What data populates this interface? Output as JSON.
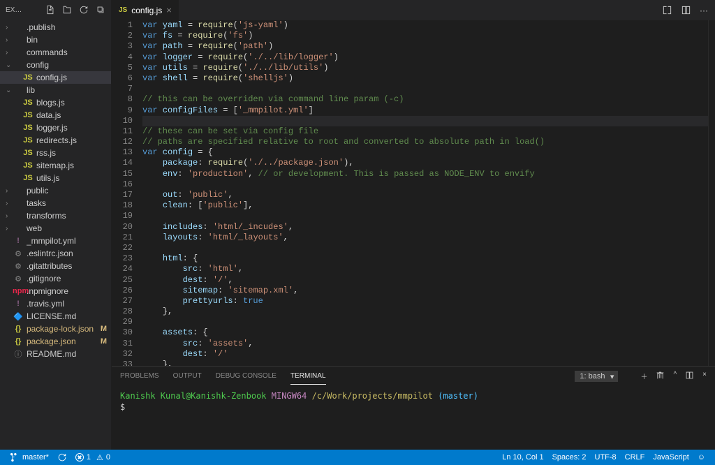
{
  "explorer": {
    "title": "EX…",
    "tree": [
      {
        "depth": 0,
        "chev": "›",
        "icon": "",
        "ic": "",
        "label": ".publish",
        "sel": false,
        "badge": ""
      },
      {
        "depth": 0,
        "chev": "›",
        "icon": "",
        "ic": "",
        "label": "bin",
        "sel": false,
        "badge": ""
      },
      {
        "depth": 0,
        "chev": "›",
        "icon": "",
        "ic": "",
        "label": "commands",
        "sel": false,
        "badge": ""
      },
      {
        "depth": 0,
        "chev": "⌄",
        "icon": "",
        "ic": "",
        "label": "config",
        "sel": false,
        "badge": ""
      },
      {
        "depth": 1,
        "chev": "",
        "icon": "JS",
        "ic": "ic-js",
        "label": "config.js",
        "sel": true,
        "badge": ""
      },
      {
        "depth": 0,
        "chev": "⌄",
        "icon": "",
        "ic": "",
        "label": "lib",
        "sel": false,
        "badge": ""
      },
      {
        "depth": 1,
        "chev": "",
        "icon": "JS",
        "ic": "ic-js",
        "label": "blogs.js",
        "sel": false,
        "badge": ""
      },
      {
        "depth": 1,
        "chev": "",
        "icon": "JS",
        "ic": "ic-js",
        "label": "data.js",
        "sel": false,
        "badge": ""
      },
      {
        "depth": 1,
        "chev": "",
        "icon": "JS",
        "ic": "ic-js",
        "label": "logger.js",
        "sel": false,
        "badge": ""
      },
      {
        "depth": 1,
        "chev": "",
        "icon": "JS",
        "ic": "ic-js",
        "label": "redirects.js",
        "sel": false,
        "badge": ""
      },
      {
        "depth": 1,
        "chev": "",
        "icon": "JS",
        "ic": "ic-js",
        "label": "rss.js",
        "sel": false,
        "badge": ""
      },
      {
        "depth": 1,
        "chev": "",
        "icon": "JS",
        "ic": "ic-js",
        "label": "sitemap.js",
        "sel": false,
        "badge": ""
      },
      {
        "depth": 1,
        "chev": "",
        "icon": "JS",
        "ic": "ic-js",
        "label": "utils.js",
        "sel": false,
        "badge": ""
      },
      {
        "depth": 0,
        "chev": "›",
        "icon": "",
        "ic": "",
        "label": "public",
        "sel": false,
        "badge": ""
      },
      {
        "depth": 0,
        "chev": "›",
        "icon": "",
        "ic": "",
        "label": "tasks",
        "sel": false,
        "badge": ""
      },
      {
        "depth": 0,
        "chev": "›",
        "icon": "",
        "ic": "",
        "label": "transforms",
        "sel": false,
        "badge": ""
      },
      {
        "depth": 0,
        "chev": "›",
        "icon": "",
        "ic": "",
        "label": "web",
        "sel": false,
        "badge": ""
      },
      {
        "depth": 0,
        "chev": "",
        "icon": "!",
        "ic": "ic-yml",
        "label": "_mmpilot.yml",
        "sel": false,
        "badge": ""
      },
      {
        "depth": 0,
        "chev": "",
        "icon": "⚙",
        "ic": "ic-txt",
        "label": ".eslintrc.json",
        "sel": false,
        "badge": ""
      },
      {
        "depth": 0,
        "chev": "",
        "icon": "⚙",
        "ic": "ic-txt",
        "label": ".gitattributes",
        "sel": false,
        "badge": ""
      },
      {
        "depth": 0,
        "chev": "",
        "icon": "⚙",
        "ic": "ic-txt",
        "label": ".gitignore",
        "sel": false,
        "badge": ""
      },
      {
        "depth": 0,
        "chev": "",
        "icon": "npm",
        "ic": "ic-npm",
        "label": ".npmignore",
        "sel": false,
        "badge": ""
      },
      {
        "depth": 0,
        "chev": "",
        "icon": "!",
        "ic": "ic-yml",
        "label": ".travis.yml",
        "sel": false,
        "badge": ""
      },
      {
        "depth": 0,
        "chev": "",
        "icon": "🔷",
        "ic": "ic-md",
        "label": "LICENSE.md",
        "sel": false,
        "badge": ""
      },
      {
        "depth": 0,
        "chev": "",
        "icon": "{}",
        "ic": "ic-json",
        "label": "package-lock.json",
        "sel": false,
        "badge": "M"
      },
      {
        "depth": 0,
        "chev": "",
        "icon": "{}",
        "ic": "ic-json",
        "label": "package.json",
        "sel": false,
        "badge": "M"
      },
      {
        "depth": 0,
        "chev": "",
        "icon": "ⓘ",
        "ic": "ic-info",
        "label": "README.md",
        "sel": false,
        "badge": ""
      }
    ]
  },
  "tab": {
    "icon": "JS",
    "label": "config.js"
  },
  "code": {
    "first_line": 1,
    "current": 10,
    "lines": [
      [
        [
          "kw",
          "var"
        ],
        [
          "",
          ""
        ],
        [
          "var",
          " yaml "
        ],
        [
          "punc",
          "= "
        ],
        [
          "fn",
          "require"
        ],
        [
          "punc",
          "("
        ],
        [
          "str",
          "'js-yaml'"
        ],
        [
          "punc",
          ")"
        ]
      ],
      [
        [
          "kw",
          "var"
        ],
        [
          "var",
          " fs "
        ],
        [
          "punc",
          "= "
        ],
        [
          "fn",
          "require"
        ],
        [
          "punc",
          "("
        ],
        [
          "str",
          "'fs'"
        ],
        [
          "punc",
          ")"
        ]
      ],
      [
        [
          "kw",
          "var"
        ],
        [
          "var",
          " path "
        ],
        [
          "punc",
          "= "
        ],
        [
          "fn",
          "require"
        ],
        [
          "punc",
          "("
        ],
        [
          "str",
          "'path'"
        ],
        [
          "punc",
          ")"
        ]
      ],
      [
        [
          "kw",
          "var"
        ],
        [
          "var",
          " logger "
        ],
        [
          "punc",
          "= "
        ],
        [
          "fn",
          "require"
        ],
        [
          "punc",
          "("
        ],
        [
          "str",
          "'./../lib/logger'"
        ],
        [
          "punc",
          ")"
        ]
      ],
      [
        [
          "kw",
          "var"
        ],
        [
          "var",
          " utils "
        ],
        [
          "punc",
          "= "
        ],
        [
          "fn",
          "require"
        ],
        [
          "punc",
          "("
        ],
        [
          "str",
          "'./../lib/utils'"
        ],
        [
          "punc",
          ")"
        ]
      ],
      [
        [
          "kw",
          "var"
        ],
        [
          "var",
          " shell "
        ],
        [
          "punc",
          "= "
        ],
        [
          "fn",
          "require"
        ],
        [
          "punc",
          "("
        ],
        [
          "str",
          "'shelljs'"
        ],
        [
          "punc",
          ")"
        ]
      ],
      [],
      [
        [
          "cmt",
          "// this can be overriden via command line param (-c)"
        ]
      ],
      [
        [
          "kw",
          "var"
        ],
        [
          "var",
          " configFiles "
        ],
        [
          "punc",
          "= ["
        ],
        [
          "str",
          "'_mmpilot.yml'"
        ],
        [
          "punc",
          "]"
        ]
      ],
      [],
      [
        [
          "cmt",
          "// these can be set via config file"
        ]
      ],
      [
        [
          "cmt",
          "// paths are specified relative to root and converted to absolute path in load()"
        ]
      ],
      [
        [
          "kw",
          "var"
        ],
        [
          "var",
          " config "
        ],
        [
          "punc",
          "= {"
        ]
      ],
      [
        [
          "",
          "    "
        ],
        [
          "prop",
          "package"
        ],
        [
          "punc",
          ": "
        ],
        [
          "fn",
          "require"
        ],
        [
          "punc",
          "("
        ],
        [
          "str",
          "'./../package.json'"
        ],
        [
          "punc",
          "),"
        ]
      ],
      [
        [
          "",
          "    "
        ],
        [
          "prop",
          "env"
        ],
        [
          "punc",
          ": "
        ],
        [
          "str",
          "'production'"
        ],
        [
          "punc",
          ", "
        ],
        [
          "cmt",
          "// or development. This is passed as NODE_ENV to envify"
        ]
      ],
      [],
      [
        [
          "",
          "    "
        ],
        [
          "prop",
          "out"
        ],
        [
          "punc",
          ": "
        ],
        [
          "str",
          "'public'"
        ],
        [
          "punc",
          ","
        ]
      ],
      [
        [
          "",
          "    "
        ],
        [
          "prop",
          "clean"
        ],
        [
          "punc",
          ": ["
        ],
        [
          "str",
          "'public'"
        ],
        [
          "punc",
          "],"
        ]
      ],
      [],
      [
        [
          "",
          "    "
        ],
        [
          "prop",
          "includes"
        ],
        [
          "punc",
          ": "
        ],
        [
          "str",
          "'html/_incudes'"
        ],
        [
          "punc",
          ","
        ]
      ],
      [
        [
          "",
          "    "
        ],
        [
          "prop",
          "layouts"
        ],
        [
          "punc",
          ": "
        ],
        [
          "str",
          "'html/_layouts'"
        ],
        [
          "punc",
          ","
        ]
      ],
      [],
      [
        [
          "",
          "    "
        ],
        [
          "prop",
          "html"
        ],
        [
          "punc",
          ": {"
        ]
      ],
      [
        [
          "",
          "        "
        ],
        [
          "prop",
          "src"
        ],
        [
          "punc",
          ": "
        ],
        [
          "str",
          "'html'"
        ],
        [
          "punc",
          ","
        ]
      ],
      [
        [
          "",
          "        "
        ],
        [
          "prop",
          "dest"
        ],
        [
          "punc",
          ": "
        ],
        [
          "str",
          "'/'"
        ],
        [
          "punc",
          ","
        ]
      ],
      [
        [
          "",
          "        "
        ],
        [
          "prop",
          "sitemap"
        ],
        [
          "punc",
          ": "
        ],
        [
          "str",
          "'sitemap.xml'"
        ],
        [
          "punc",
          ","
        ]
      ],
      [
        [
          "",
          "        "
        ],
        [
          "prop",
          "prettyurls"
        ],
        [
          "punc",
          ": "
        ],
        [
          "bool",
          "true"
        ]
      ],
      [
        [
          "",
          "    "
        ],
        [
          "punc",
          "},"
        ]
      ],
      [],
      [
        [
          "",
          "    "
        ],
        [
          "prop",
          "assets"
        ],
        [
          "punc",
          ": {"
        ]
      ],
      [
        [
          "",
          "        "
        ],
        [
          "prop",
          "src"
        ],
        [
          "punc",
          ": "
        ],
        [
          "str",
          "'assets'"
        ],
        [
          "punc",
          ","
        ]
      ],
      [
        [
          "",
          "        "
        ],
        [
          "prop",
          "dest"
        ],
        [
          "punc",
          ": "
        ],
        [
          "str",
          "'/'"
        ]
      ],
      [
        [
          "",
          "    "
        ],
        [
          "punc",
          "},"
        ]
      ],
      []
    ]
  },
  "panel": {
    "tabs": [
      "PROBLEMS",
      "OUTPUT",
      "DEBUG CONSOLE",
      "TERMINAL"
    ],
    "active": 3,
    "term_dd": "1: bash",
    "prompt": {
      "user": "Kanishk Kunal@Kanishk-Zenbook",
      "sys": "MINGW64",
      "path": "/c/Work/projects/mmpilot",
      "branch": "(master)",
      "cursor": "$"
    }
  },
  "status": {
    "branch": "master*",
    "errors": "1",
    "warnings": "0",
    "lncol": "Ln 10, Col 1",
    "spaces": "Spaces: 2",
    "enc": "UTF-8",
    "eol": "CRLF",
    "lang": "JavaScript"
  }
}
